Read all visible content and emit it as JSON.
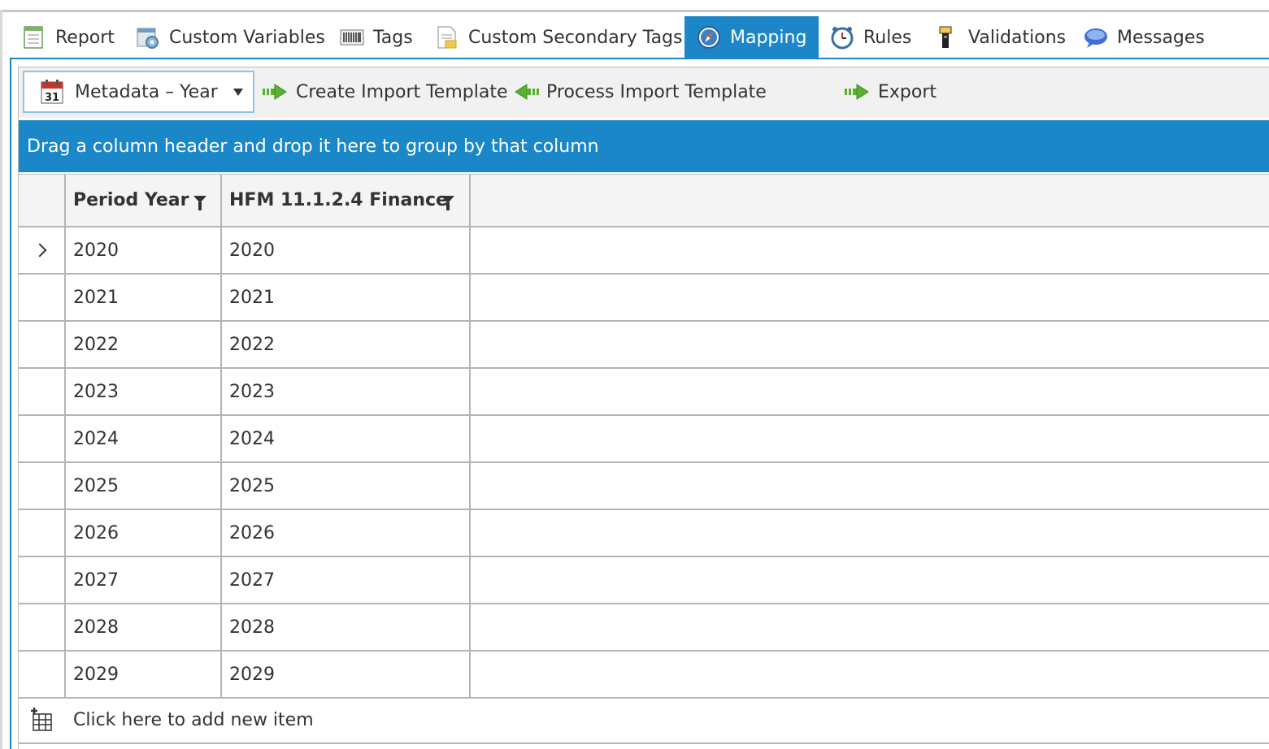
{
  "tabs": [
    {
      "label": "Report",
      "icon": "report-icon",
      "active": false
    },
    {
      "label": "Custom Variables",
      "icon": "custom-variables-icon",
      "active": false
    },
    {
      "label": "Tags",
      "icon": "barcode-icon",
      "active": false
    },
    {
      "label": "Custom Secondary Tags",
      "icon": "document-icon",
      "active": false
    },
    {
      "label": "Mapping",
      "icon": "compass-icon",
      "active": true
    },
    {
      "label": "Rules",
      "icon": "clock-icon",
      "active": false
    },
    {
      "label": "Validations",
      "icon": "flashlight-icon",
      "active": false
    },
    {
      "label": "Messages",
      "icon": "chat-bubble-icon",
      "active": false
    }
  ],
  "toolbar": {
    "dropdown_label": "Metadata – Year",
    "dropdown_icon": "calendar-icon",
    "calendar_day": "31",
    "create_label": "Create Import Template",
    "process_label": "Process Import Template",
    "export_label": "Export"
  },
  "group_bar": "Drag a column header and drop it here to group by that column",
  "grid": {
    "columns": [
      "Period Year",
      "HFM 11.1.2.4 Finance"
    ],
    "rows": [
      [
        "2020",
        "2020"
      ],
      [
        "2021",
        "2021"
      ],
      [
        "2022",
        "2022"
      ],
      [
        "2023",
        "2023"
      ],
      [
        "2024",
        "2024"
      ],
      [
        "2025",
        "2025"
      ],
      [
        "2026",
        "2026"
      ],
      [
        "2027",
        "2027"
      ],
      [
        "2028",
        "2028"
      ],
      [
        "2029",
        "2029"
      ]
    ],
    "add_new_label": "Click here to add new item"
  },
  "colors": {
    "accent": "#1c86c8",
    "group_bar": "#1a87c9"
  }
}
